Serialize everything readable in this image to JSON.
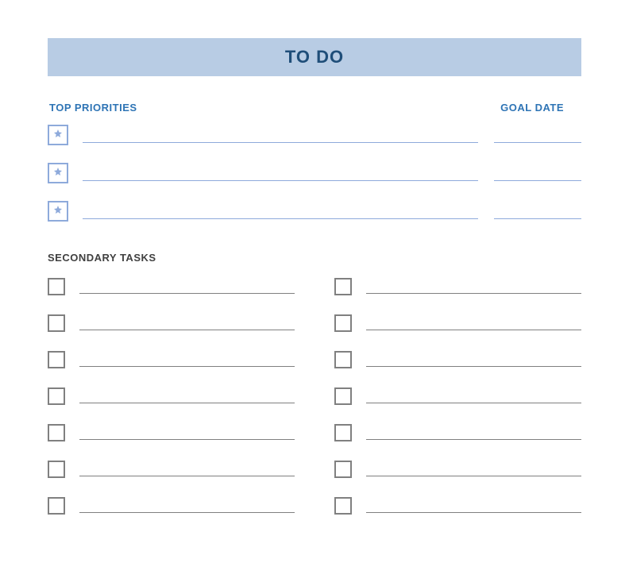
{
  "title": "TO DO",
  "sections": {
    "priorities_label": "TOP PRIORITIES",
    "goal_date_label": "GOAL DATE",
    "secondary_label": "SECONDARY TASKS"
  },
  "priorities": [
    {
      "task": "",
      "goal_date": ""
    },
    {
      "task": "",
      "goal_date": ""
    },
    {
      "task": "",
      "goal_date": ""
    }
  ],
  "secondary_tasks_left": [
    {
      "task": ""
    },
    {
      "task": ""
    },
    {
      "task": ""
    },
    {
      "task": ""
    },
    {
      "task": ""
    },
    {
      "task": ""
    },
    {
      "task": ""
    }
  ],
  "secondary_tasks_right": [
    {
      "task": ""
    },
    {
      "task": ""
    },
    {
      "task": ""
    },
    {
      "task": ""
    },
    {
      "task": ""
    },
    {
      "task": ""
    },
    {
      "task": ""
    }
  ]
}
